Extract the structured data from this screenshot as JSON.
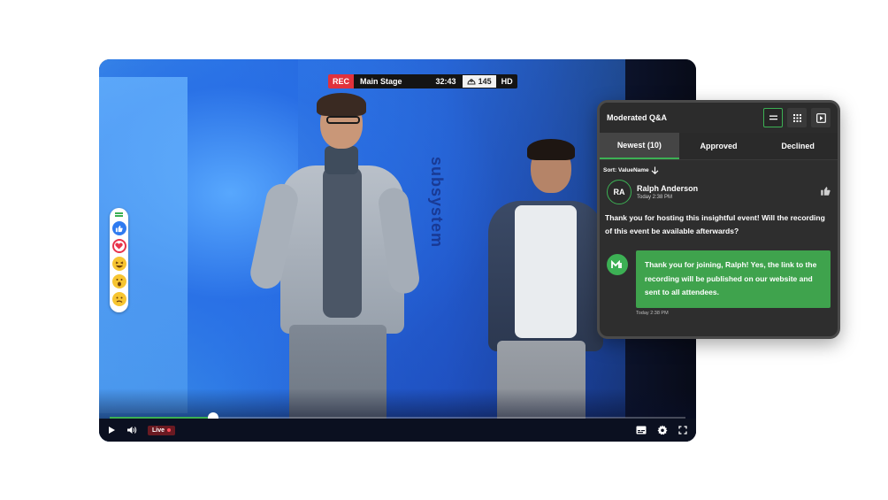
{
  "player": {
    "stage_backdrop_text": "subsystem",
    "topbar": {
      "rec": "REC",
      "stage_name": "Main Stage",
      "elapsed": "32:43",
      "viewers": "145",
      "quality": "HD"
    },
    "progress_fraction": 0.18,
    "live_label": "Live",
    "icons": {
      "play": "play-icon",
      "volume": "volume-icon",
      "captions": "captions-icon",
      "settings": "gear-icon",
      "fullscreen": "fullscreen-icon"
    }
  },
  "reactions": [
    "like-reaction",
    "love-reaction",
    "laugh-reaction",
    "wow-reaction",
    "confused-reaction"
  ],
  "qa": {
    "title": "Moderated Q&A",
    "tabs": [
      {
        "label": "Newest (10)",
        "active": true
      },
      {
        "label": "Approved",
        "active": false
      },
      {
        "label": "Declined",
        "active": false
      }
    ],
    "sort_label": "Sort: ValueName",
    "question": {
      "initials": "RA",
      "name": "Ralph Anderson",
      "time": "Today 2:38 PM",
      "text": "Thank you for hosting this insightful event! Will the recording of this event be available afterwards?"
    },
    "answer": {
      "text": "Thank you for joining, Ralph! Yes, the link to the recording will be published on our website and sent to all attendees.",
      "time": "Today 2:38 PM"
    }
  },
  "colors": {
    "accent_green": "#3cb054",
    "rec_red": "#e0323c",
    "panel_bg": "#2e2e2e"
  }
}
